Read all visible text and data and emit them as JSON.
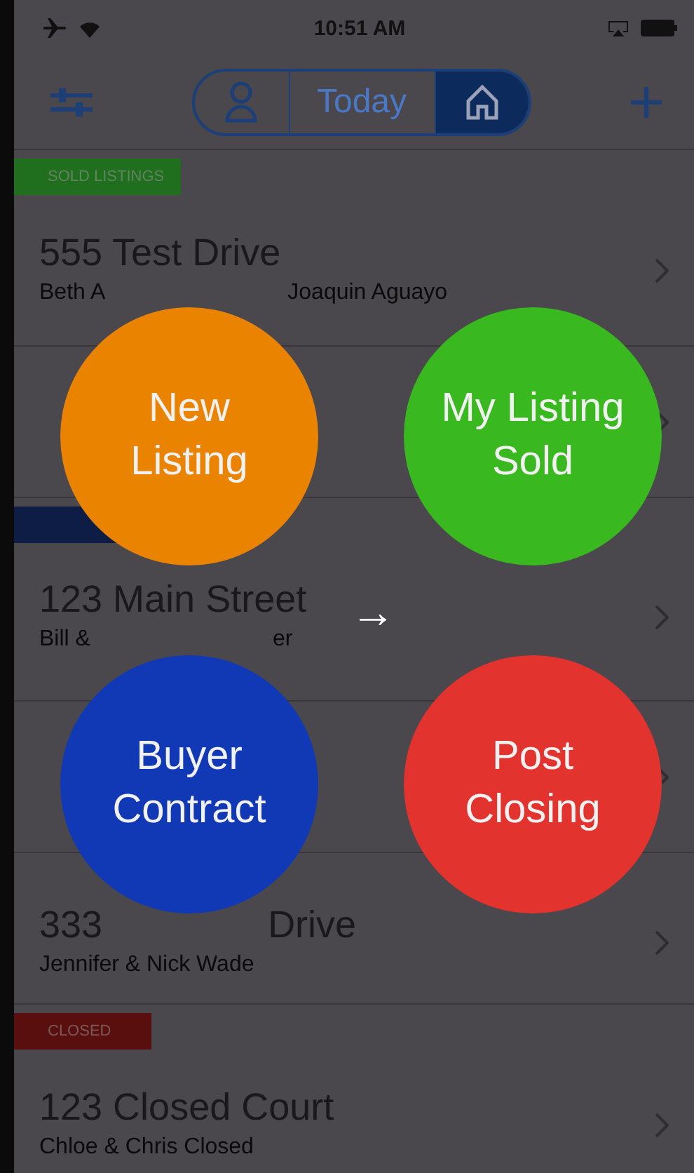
{
  "status_bar": {
    "time": "10:51 AM"
  },
  "nav": {
    "segments": [
      {
        "kind": "person",
        "selected": false
      },
      {
        "kind": "text",
        "label": "Today",
        "selected": false
      },
      {
        "kind": "home",
        "selected": true
      }
    ]
  },
  "list": [
    {
      "kind": "header",
      "label": "SOLD LISTINGS",
      "color": "#1f6f1f"
    },
    {
      "kind": "row",
      "title": [
        "555 Test Drive"
      ],
      "subtitle": [
        "Beth A",
        "Joaquin Aguayo"
      ]
    },
    {
      "kind": "row"
    },
    {
      "kind": "header",
      "color": "#0d1d45"
    },
    {
      "kind": "row",
      "title": [
        "123 Main Street"
      ],
      "subtitle": [
        "Bill &",
        "er"
      ]
    },
    {
      "kind": "row"
    },
    {
      "kind": "row",
      "title": [
        "333",
        "Drive"
      ],
      "subtitle": [
        "Jennifer & Nick Wade"
      ]
    },
    {
      "kind": "header",
      "label": "CLOSED",
      "color": "#5a0f0f"
    },
    {
      "kind": "row",
      "title": [
        "123 Closed Court"
      ],
      "subtitle": [
        "Chloe & Chris Closed"
      ]
    }
  ],
  "actions": [
    {
      "lines": [
        "New",
        "Listing"
      ],
      "color": "#ea8300"
    },
    {
      "lines": [
        "My Listing",
        "Sold"
      ],
      "color": "#39b81f"
    },
    {
      "lines": [
        "Buyer",
        "Contract"
      ],
      "color": "#1138b5"
    },
    {
      "lines": [
        "Post",
        "Closing"
      ],
      "color": "#e3332e"
    }
  ],
  "hint_arrow": "→"
}
